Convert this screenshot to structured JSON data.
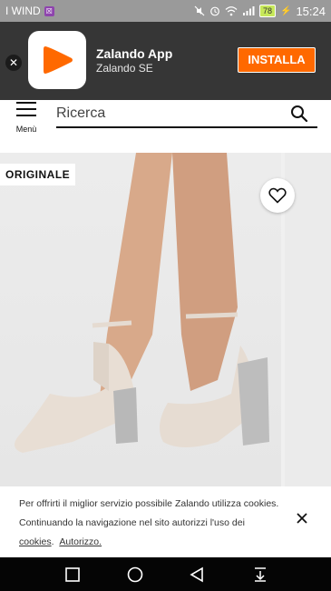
{
  "status_bar": {
    "carrier": "I WIND",
    "carrier_badge": "☒",
    "battery": "78",
    "time": "15:24"
  },
  "app_banner": {
    "app_name": "Zalando App",
    "publisher": "Zalando SE",
    "install_label": "INSTALLA",
    "brand_color": "#ff6900"
  },
  "header": {
    "menu_label": "Menù",
    "search_placeholder": "Ricerca"
  },
  "product": {
    "badge": "ORIGINALE"
  },
  "cookie_banner": {
    "text_before": "Per offrirti il miglior servizio possibile Zalando utilizza cookies. Continuando la navigazione nel sito autorizzi l'uso dei ",
    "cookies_link": "cookies",
    "separator": ".",
    "authorize_link": "Autorizzo."
  },
  "icons": {
    "close": "close-icon",
    "menu": "hamburger-icon",
    "search": "search-icon",
    "wishlist": "heart-icon",
    "nav_recents": "square-icon",
    "nav_home": "circle-icon",
    "nav_back": "triangle-back-icon",
    "nav_download": "download-icon"
  }
}
